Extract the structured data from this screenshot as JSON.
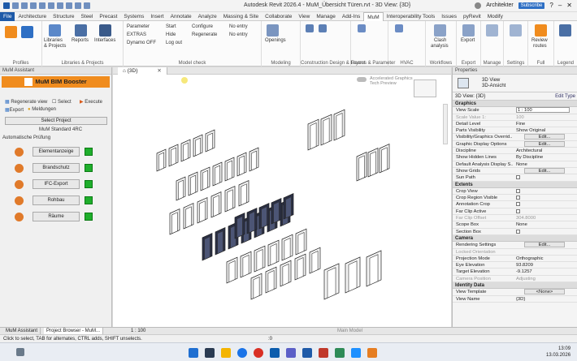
{
  "titlebar": {
    "title": "Autodesk Revit 2026.4 - MuM_Übersicht Türen.rvt - 3D View: {3D}",
    "user": "Architekter",
    "subscribe": "Subscribe"
  },
  "menu_tabs": [
    "File",
    "Architecture",
    "Structure",
    "Steel",
    "Precast",
    "Systems",
    "Insert",
    "Annotate",
    "Analyze",
    "Massing & Site",
    "Collaborate",
    "View",
    "Manage",
    "Add-Ins",
    "MuM",
    "Interoperability Tools",
    "Issues",
    "pyRevit",
    "Modify"
  ],
  "active_tab": "MuM",
  "ribbon": {
    "groups": [
      {
        "label": "Profiles"
      },
      {
        "label": "Libraries & Projects"
      },
      {
        "label": "Model check"
      },
      {
        "label": "Modeling"
      },
      {
        "label": "Construction Design & Layout"
      },
      {
        "label": "Rooms & Parameter"
      },
      {
        "label": "HVAC"
      },
      {
        "label": "Workflows"
      },
      {
        "label": "Export"
      },
      {
        "label": "Manage"
      },
      {
        "label": "Settings"
      },
      {
        "label": "Full"
      },
      {
        "label": "Legend"
      }
    ],
    "texts": {
      "libraries": "Libraries",
      "projects": "& Projects",
      "reports": "Reports",
      "interfaces": "Interfaces",
      "parameter": "Parameter",
      "extras": "EXTRAS",
      "dynamo": "Dynamo OFF",
      "start": "Start",
      "hide": "Hide",
      "logout": "Log out",
      "configure": "Configure",
      "regenerate": "Regenerate",
      "no_entry_1": "No entry",
      "no_entry_2": "No entry",
      "openings": "Openings",
      "clash": "Clash",
      "analysis": "analysis",
      "export": "Export",
      "review": "Review",
      "routes": "routes"
    }
  },
  "left_panel": {
    "header": "MuM Assistant",
    "banner": "MuM BIM Booster",
    "regenerate_view": "Regenerate view",
    "select": "Select",
    "execute": "Execute",
    "export": "Export",
    "messages": "Meldungen",
    "select_project": "Select Project",
    "standard": "MuM Standard 4RC",
    "auto_check": "Automatische Prüfung",
    "checks": [
      {
        "label": "Elementanzeige",
        "icon": "element-icon",
        "color": "#e07a2a"
      },
      {
        "label": "Brandschutz",
        "icon": "fire-protection-icon",
        "color": "#e07a2a"
      },
      {
        "label": "IFC-Export",
        "icon": "ifc-icon",
        "color": "#e07a2a"
      },
      {
        "label": "Rohbau",
        "icon": "shell-construction-icon",
        "color": "#e07a2a"
      },
      {
        "label": "Räume",
        "icon": "rooms-icon",
        "color": "#e07a2a"
      }
    ]
  },
  "viewport": {
    "tab": "{3D}",
    "accel_1": "Accelerated Graphics",
    "accel_2": "Tech Preview"
  },
  "properties": {
    "header": "Properties",
    "type_1": "3D View",
    "type_2": "3D-Ansicht",
    "selector": "3D View: {3D}",
    "edit_type": "Edit Type",
    "sections": [
      {
        "name": "Graphics",
        "rows": [
          {
            "k": "View Scale",
            "v": "1 : 100",
            "style": "box"
          },
          {
            "k": "Scale Value  1:",
            "v": "100",
            "style": "grey"
          },
          {
            "k": "Detail Level",
            "v": "Fine"
          },
          {
            "k": "Parts Visibility",
            "v": "Show Original"
          },
          {
            "k": "Visibility/Graphics Overrid...",
            "v": "Edit...",
            "style": "btn"
          },
          {
            "k": "Graphic Display Options",
            "v": "Edit...",
            "style": "btn"
          },
          {
            "k": "Discipline",
            "v": "Architectural"
          },
          {
            "k": "Show Hidden Lines",
            "v": "By Discipline"
          },
          {
            "k": "Default Analysis Display S...",
            "v": "None"
          },
          {
            "k": "Show Grids",
            "v": "Edit...",
            "style": "btn"
          },
          {
            "k": "Sun Path",
            "v": "",
            "style": "cb"
          }
        ]
      },
      {
        "name": "Extents",
        "rows": [
          {
            "k": "Crop View",
            "v": "",
            "style": "cb"
          },
          {
            "k": "Crop Region Visible",
            "v": "",
            "style": "cb"
          },
          {
            "k": "Annotation Crop",
            "v": "",
            "style": "cb"
          },
          {
            "k": "Far Clip Active",
            "v": "",
            "style": "cb"
          },
          {
            "k": "Far Clip Offset",
            "v": "304.8000",
            "style": "grey"
          },
          {
            "k": "Scope Box",
            "v": "None"
          },
          {
            "k": "Section Box",
            "v": "",
            "style": "cb"
          }
        ]
      },
      {
        "name": "Camera",
        "rows": [
          {
            "k": "Rendering Settings",
            "v": "Edit...",
            "style": "btn"
          },
          {
            "k": "Locked Orientation",
            "v": "",
            "style": "grey"
          },
          {
            "k": "Projection Mode",
            "v": "Orthographic"
          },
          {
            "k": "Eye Elevation",
            "v": "93.8209"
          },
          {
            "k": "Target Elevation",
            "v": "-9.1257"
          },
          {
            "k": "Camera Position",
            "v": "Adjusting",
            "style": "grey"
          }
        ]
      },
      {
        "name": "Identity Data",
        "rows": [
          {
            "k": "View Template",
            "v": "<None>",
            "style": "btn"
          },
          {
            "k": "View Name",
            "v": "{3D}"
          }
        ]
      }
    ]
  },
  "bottom_tabs": {
    "tab1": "MuM Assistant",
    "tab2": "Project Browser - MuM...",
    "scale": "1 : 100",
    "main_model": "Main Model"
  },
  "status": {
    "text": "Click to select, TAB for alternates, CTRL adds, SHIFT unselects.",
    "zero": ":0"
  },
  "taskbar": {
    "time": "13:09",
    "date": "13.03.2026"
  }
}
